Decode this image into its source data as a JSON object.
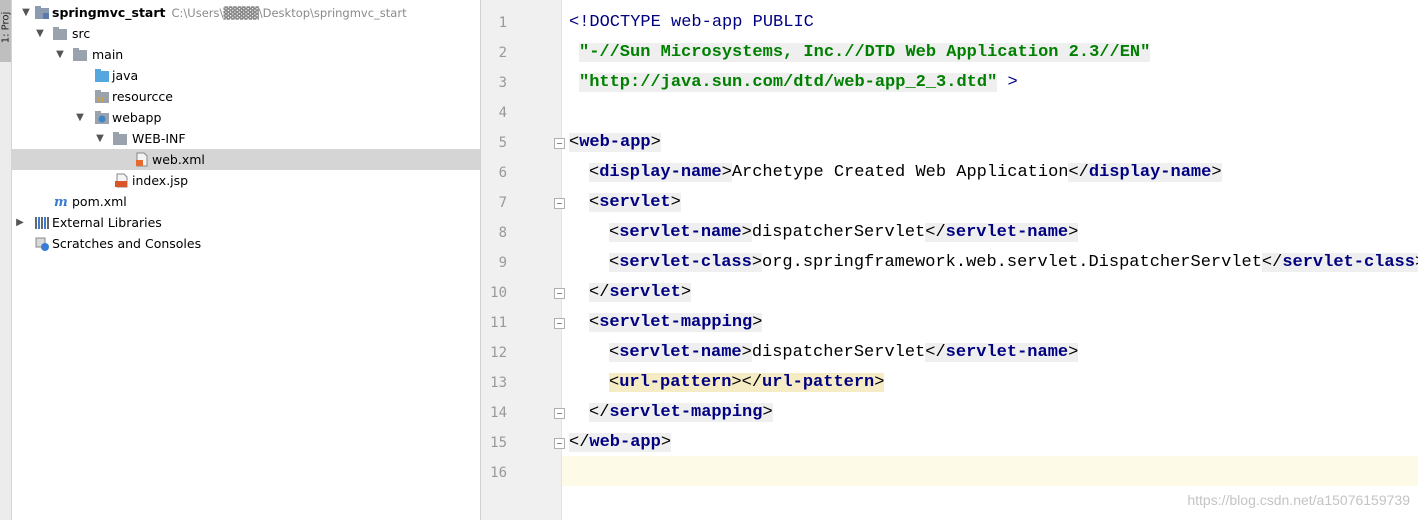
{
  "tool_window": {
    "label": "1: Proj"
  },
  "project_tree": {
    "root": {
      "label": "springmvc_start",
      "path": "C:\\Users\\▓▓▓▓\\Desktop\\springmvc_start"
    },
    "items": [
      {
        "label": "src"
      },
      {
        "label": "main"
      },
      {
        "label": "java"
      },
      {
        "label": "resourcce"
      },
      {
        "label": "webapp"
      },
      {
        "label": "WEB-INF"
      },
      {
        "label": "web.xml"
      },
      {
        "label": "index.jsp"
      },
      {
        "label": "pom.xml"
      },
      {
        "label": "External Libraries"
      },
      {
        "label": "Scratches and Consoles"
      }
    ]
  },
  "editor": {
    "line_numbers": [
      "1",
      "2",
      "3",
      "4",
      "5",
      "6",
      "7",
      "8",
      "9",
      "10",
      "11",
      "12",
      "13",
      "14",
      "15",
      "16"
    ],
    "code": {
      "l1_doctype": "<!DOCTYPE",
      "l1_webapp": "web-app",
      "l1_public": "PUBLIC",
      "l2_str": "\"-//Sun Microsystems, Inc.//DTD Web Application 2.3//EN\"",
      "l3_str": "\"http://java.sun.com/dtd/web-app_2_3.dtd\"",
      "l3_close": ">",
      "web_app": "web-app",
      "display_name": "display-name",
      "display_name_text": "Archetype Created Web Application",
      "servlet": "servlet",
      "servlet_name": "servlet-name",
      "dispatcher": "dispatcherServlet",
      "servlet_class": "servlet-class",
      "servlet_class_text": "org.springframework.web.servlet.DispatcherServlet",
      "servlet_mapping": "servlet-mapping",
      "url_pattern": "url-pattern"
    }
  },
  "watermark": "https://blog.csdn.net/a15076159739",
  "colors": {
    "tag": "#000080",
    "string": "#008000",
    "selected_row": "#d5d5d5",
    "current_line": "#fdfae8",
    "gutter": "#f0f0f0"
  }
}
